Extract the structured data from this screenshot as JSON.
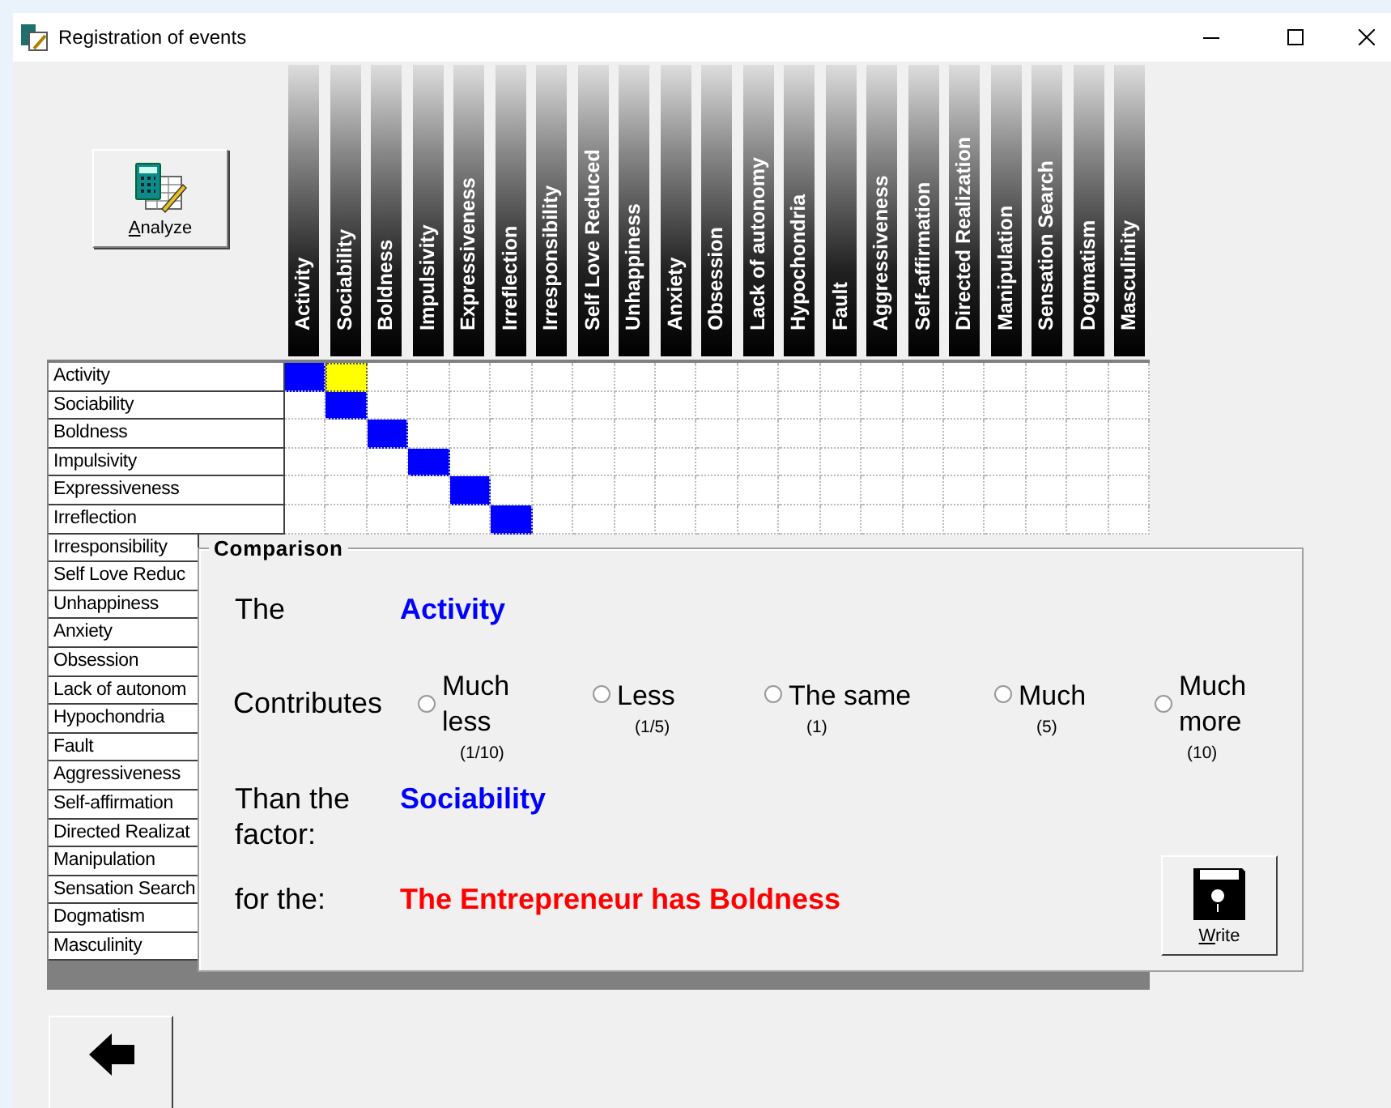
{
  "window": {
    "title": "Registration of events"
  },
  "analyze_button": {
    "label": "Analyze"
  },
  "columns": [
    "Activity",
    "Sociability",
    "Boldness",
    "Impulsivity",
    "Expressiveness",
    "Irreflection",
    "Irresponsibility",
    "Self Love Reduced",
    "Unhappiness",
    "Anxiety",
    "Obsession",
    "Lack of autonomy",
    "Hypochondria",
    "Fault",
    "Aggressiveness",
    "Self-affirmation",
    "Directed Realization",
    "Manipulation",
    "Sensation Search",
    "Dogmatism",
    "Masculinity"
  ],
  "rows": [
    {
      "label": "Activity",
      "cells": [
        {
          "filled": true,
          "selected": false
        },
        {
          "filled": false,
          "selected": true
        },
        {
          "filled": false,
          "selected": false
        },
        {
          "filled": false,
          "selected": false
        },
        {
          "filled": false,
          "selected": false
        },
        {
          "filled": false,
          "selected": false
        },
        {
          "filled": false,
          "selected": false
        },
        {
          "filled": false,
          "selected": false
        },
        {
          "filled": false,
          "selected": false
        },
        {
          "filled": false,
          "selected": false
        },
        {
          "filled": false,
          "selected": false
        },
        {
          "filled": false,
          "selected": false
        },
        {
          "filled": false,
          "selected": false
        },
        {
          "filled": false,
          "selected": false
        },
        {
          "filled": false,
          "selected": false
        },
        {
          "filled": false,
          "selected": false
        },
        {
          "filled": false,
          "selected": false
        },
        {
          "filled": false,
          "selected": false
        },
        {
          "filled": false,
          "selected": false
        },
        {
          "filled": false,
          "selected": false
        },
        {
          "filled": false,
          "selected": false
        }
      ]
    },
    {
      "label": "Sociability",
      "cells": [
        {
          "filled": false,
          "selected": false
        },
        {
          "filled": true,
          "selected": false
        },
        {
          "filled": false,
          "selected": false
        },
        {
          "filled": false,
          "selected": false
        },
        {
          "filled": false,
          "selected": false
        },
        {
          "filled": false,
          "selected": false
        },
        {
          "filled": false,
          "selected": false
        },
        {
          "filled": false,
          "selected": false
        },
        {
          "filled": false,
          "selected": false
        },
        {
          "filled": false,
          "selected": false
        },
        {
          "filled": false,
          "selected": false
        },
        {
          "filled": false,
          "selected": false
        },
        {
          "filled": false,
          "selected": false
        },
        {
          "filled": false,
          "selected": false
        },
        {
          "filled": false,
          "selected": false
        },
        {
          "filled": false,
          "selected": false
        },
        {
          "filled": false,
          "selected": false
        },
        {
          "filled": false,
          "selected": false
        },
        {
          "filled": false,
          "selected": false
        },
        {
          "filled": false,
          "selected": false
        },
        {
          "filled": false,
          "selected": false
        }
      ]
    },
    {
      "label": "Boldness",
      "cells": [
        {
          "filled": false,
          "selected": false
        },
        {
          "filled": false,
          "selected": false
        },
        {
          "filled": true,
          "selected": false
        },
        {
          "filled": false,
          "selected": false
        },
        {
          "filled": false,
          "selected": false
        },
        {
          "filled": false,
          "selected": false
        },
        {
          "filled": false,
          "selected": false
        },
        {
          "filled": false,
          "selected": false
        },
        {
          "filled": false,
          "selected": false
        },
        {
          "filled": false,
          "selected": false
        },
        {
          "filled": false,
          "selected": false
        },
        {
          "filled": false,
          "selected": false
        },
        {
          "filled": false,
          "selected": false
        },
        {
          "filled": false,
          "selected": false
        },
        {
          "filled": false,
          "selected": false
        },
        {
          "filled": false,
          "selected": false
        },
        {
          "filled": false,
          "selected": false
        },
        {
          "filled": false,
          "selected": false
        },
        {
          "filled": false,
          "selected": false
        },
        {
          "filled": false,
          "selected": false
        },
        {
          "filled": false,
          "selected": false
        }
      ]
    },
    {
      "label": "Impulsivity",
      "cells": [
        {
          "filled": false,
          "selected": false
        },
        {
          "filled": false,
          "selected": false
        },
        {
          "filled": false,
          "selected": false
        },
        {
          "filled": true,
          "selected": false
        },
        {
          "filled": false,
          "selected": false
        },
        {
          "filled": false,
          "selected": false
        },
        {
          "filled": false,
          "selected": false
        },
        {
          "filled": false,
          "selected": false
        },
        {
          "filled": false,
          "selected": false
        },
        {
          "filled": false,
          "selected": false
        },
        {
          "filled": false,
          "selected": false
        },
        {
          "filled": false,
          "selected": false
        },
        {
          "filled": false,
          "selected": false
        },
        {
          "filled": false,
          "selected": false
        },
        {
          "filled": false,
          "selected": false
        },
        {
          "filled": false,
          "selected": false
        },
        {
          "filled": false,
          "selected": false
        },
        {
          "filled": false,
          "selected": false
        },
        {
          "filled": false,
          "selected": false
        },
        {
          "filled": false,
          "selected": false
        },
        {
          "filled": false,
          "selected": false
        }
      ]
    },
    {
      "label": "Expressiveness",
      "cells": [
        {
          "filled": false,
          "selected": false
        },
        {
          "filled": false,
          "selected": false
        },
        {
          "filled": false,
          "selected": false
        },
        {
          "filled": false,
          "selected": false
        },
        {
          "filled": true,
          "selected": false
        },
        {
          "filled": false,
          "selected": false
        },
        {
          "filled": false,
          "selected": false
        },
        {
          "filled": false,
          "selected": false
        },
        {
          "filled": false,
          "selected": false
        },
        {
          "filled": false,
          "selected": false
        },
        {
          "filled": false,
          "selected": false
        },
        {
          "filled": false,
          "selected": false
        },
        {
          "filled": false,
          "selected": false
        },
        {
          "filled": false,
          "selected": false
        },
        {
          "filled": false,
          "selected": false
        },
        {
          "filled": false,
          "selected": false
        },
        {
          "filled": false,
          "selected": false
        },
        {
          "filled": false,
          "selected": false
        },
        {
          "filled": false,
          "selected": false
        },
        {
          "filled": false,
          "selected": false
        },
        {
          "filled": false,
          "selected": false
        }
      ]
    },
    {
      "label": "Irreflection",
      "cells": [
        {
          "filled": false,
          "selected": false
        },
        {
          "filled": false,
          "selected": false
        },
        {
          "filled": false,
          "selected": false
        },
        {
          "filled": false,
          "selected": false
        },
        {
          "filled": false,
          "selected": false
        },
        {
          "filled": true,
          "selected": false
        },
        {
          "filled": false,
          "selected": false
        },
        {
          "filled": false,
          "selected": false
        },
        {
          "filled": false,
          "selected": false
        },
        {
          "filled": false,
          "selected": false
        },
        {
          "filled": false,
          "selected": false
        },
        {
          "filled": false,
          "selected": false
        },
        {
          "filled": false,
          "selected": false
        },
        {
          "filled": false,
          "selected": false
        },
        {
          "filled": false,
          "selected": false
        },
        {
          "filled": false,
          "selected": false
        },
        {
          "filled": false,
          "selected": false
        },
        {
          "filled": false,
          "selected": false
        },
        {
          "filled": false,
          "selected": false
        },
        {
          "filled": false,
          "selected": false
        },
        {
          "filled": false,
          "selected": false
        }
      ]
    },
    {
      "label": "Irresponsibility"
    },
    {
      "label": "Self Love Reduc"
    },
    {
      "label": "Unhappiness"
    },
    {
      "label": "Anxiety"
    },
    {
      "label": "Obsession"
    },
    {
      "label": "Lack of autonom"
    },
    {
      "label": "Hypochondria"
    },
    {
      "label": "Fault"
    },
    {
      "label": "Aggressiveness"
    },
    {
      "label": "Self-affirmation"
    },
    {
      "label": "Directed Realizat"
    },
    {
      "label": "Manipulation"
    },
    {
      "label": "Sensation Search"
    },
    {
      "label": "Dogmatism"
    },
    {
      "label": "Masculinity"
    }
  ],
  "comparison": {
    "title": "Comparison",
    "the": {
      "label": "The",
      "value": "Activity"
    },
    "contributes": {
      "label": "Contributes",
      "options": [
        {
          "label": "Much less",
          "value": "(1/10)",
          "selected": false
        },
        {
          "label": "Less",
          "value": "(1/5)",
          "selected": false
        },
        {
          "label": "The same",
          "value": "(1)",
          "selected": false
        },
        {
          "label": "Much",
          "value": "(5)",
          "selected": false
        },
        {
          "label": "Much more",
          "value": "(10)",
          "selected": false
        }
      ]
    },
    "than": {
      "label": "Than the factor:",
      "value": "Sociability"
    },
    "for": {
      "label": "for the:",
      "value": "The Entrepreneur has Boldness"
    },
    "write_button": {
      "label": "Write"
    }
  }
}
